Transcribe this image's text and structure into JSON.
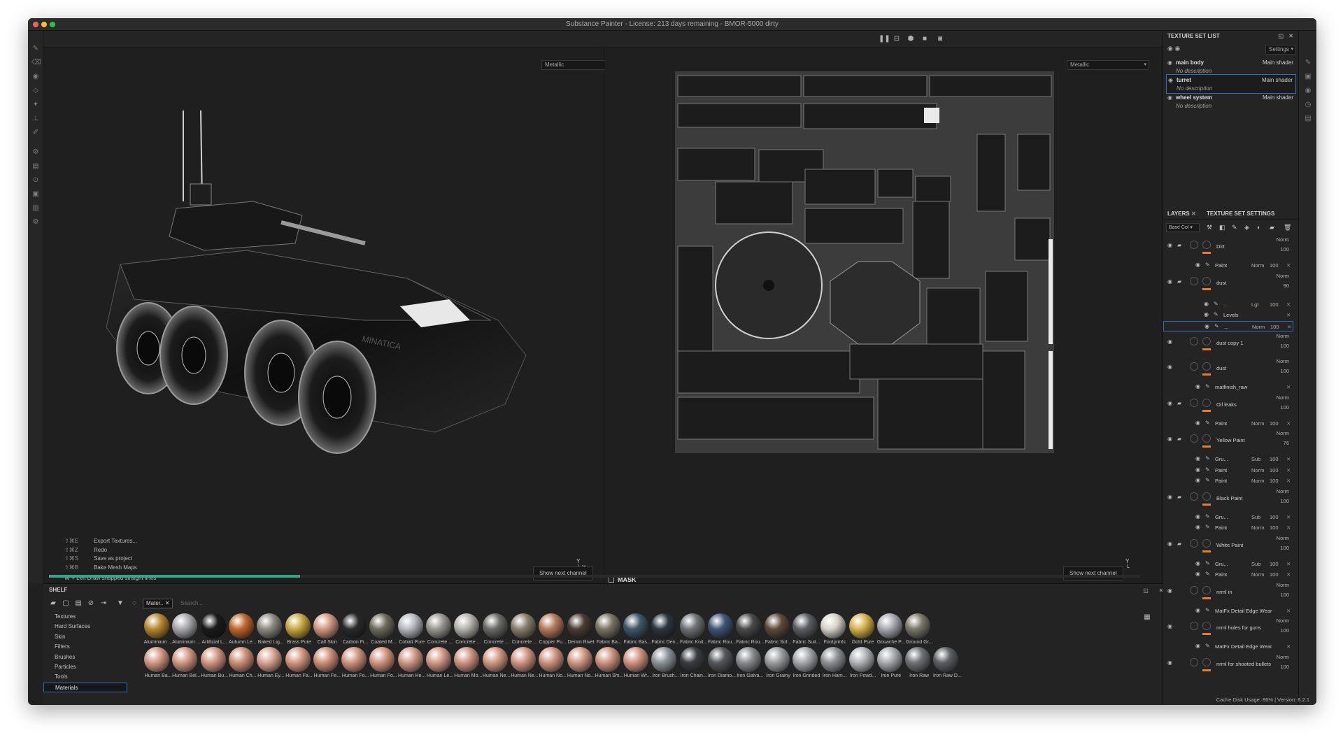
{
  "window": {
    "title": "Substance Painter - License: 213 days remaining - BMOR-5000 dirty"
  },
  "viewport": {
    "left_channel": "Metallic",
    "right_channel": "Metallic",
    "show_next_channel": "Show next channel",
    "mask_label": "MASK",
    "hint": "⌘ + Left  Draw snapped straight lines",
    "shortcuts": [
      {
        "keys": "⇧⌘E",
        "label": "Export Textures..."
      },
      {
        "keys": "⇧⌘Z",
        "label": "Redo"
      },
      {
        "keys": "⇧⌘S",
        "label": "Save as project"
      },
      {
        "keys": "⇧⌘B",
        "label": "Bake Mesh Maps"
      }
    ],
    "decal_text": "MINATICA",
    "progress": 0.23
  },
  "shelf": {
    "title": "SHELF",
    "filter_chip": "Mater..",
    "search_placeholder": "Search...",
    "categories": [
      "Textures",
      "Hard Surfaces",
      "Skin",
      "Filters",
      "Brushes",
      "Particles",
      "Tools",
      "Materials"
    ],
    "active_category": "Materials",
    "materials_row1": [
      "Aluminium ...",
      "Aluminium ...",
      "Artificial L...",
      "Autumn Le...",
      "Baked Lig...",
      "Brass Pure",
      "Calf Skin",
      "Carbon Fi...",
      "Coated M...",
      "Cobalt Pure",
      "Concrete ...",
      "Concrete ...",
      "Concrete ...",
      "Concrete ...",
      "Copper Pu...",
      "Denim Rivet",
      "Fabric Ba...",
      "Fabric Bas...",
      "Fabric Den...",
      "Fabric Knit...",
      "Fabric Rou...",
      "Fabric Rou...",
      "Fabric Sof...",
      "Fabric Suit...",
      "Footprints",
      "Gold Pure",
      "Gouache P...",
      "Ground Gr..."
    ],
    "materials_row2": [
      "Human Ba...",
      "Human Bel...",
      "Human Bu...",
      "Human Ch...",
      "Human Ey...",
      "Human Fa...",
      "Human Fe...",
      "Human Fo...",
      "Human Fo...",
      "Human He...",
      "Human Le...",
      "Human Mo...",
      "Human Ne...",
      "Human Ne...",
      "Human No...",
      "Human No...",
      "Human Shi...",
      "Human Wr...",
      "Iron Brush...",
      "Iron Chain...",
      "Iron Diamo...",
      "Iron Galva...",
      "Iron Grainy",
      "Iron Grinded",
      "Iron Ham...",
      "Iron Powd...",
      "Iron Pure",
      "Iron Raw",
      "Iron Raw D..."
    ],
    "row1_colors": [
      "#b8892e",
      "#a9a9ad",
      "#1a1a1a",
      "#c0672d",
      "#8e8a83",
      "#c9a93f",
      "#d39a82",
      "#2a2a2a",
      "#6f6b5e",
      "#b7b9c0",
      "#9a9892",
      "#b4b3ae",
      "#6a6a69",
      "#8a7f70",
      "#b57a5c",
      "#4b3b34",
      "#7a7464",
      "#3e5868",
      "#2d3540",
      "#6f7276",
      "#3e5674",
      "#4a4a4a",
      "#5e4a3c",
      "#5c5e63",
      "#d8d4cc",
      "#d7b34a",
      "#a9aab2",
      "#7a776a"
    ],
    "row2_colors": [
      "#d59a85",
      "#d49a84",
      "#d49883",
      "#cf9079",
      "#dba690",
      "#d69882",
      "#cf9077",
      "#d09580",
      "#d3977f",
      "#d29a85",
      "#d49b86",
      "#d29682",
      "#d29983",
      "#d19782",
      "#cf9580",
      "#d19984",
      "#d09580",
      "#d09580",
      "#8e9399",
      "#3a3c40",
      "#55585c",
      "#8a8c8f",
      "#9c9ea0",
      "#a7a9ac",
      "#8f9194",
      "#b2b4b7",
      "#a9abae",
      "#6f7175",
      "#5d5f62"
    ]
  },
  "texture_sets": {
    "title": "TEXTURE SET LIST",
    "settings_label": "Settings",
    "items": [
      {
        "name": "main body",
        "shader": "Main shader",
        "description": "No description"
      },
      {
        "name": "turret",
        "shader": "Main shader",
        "description": "No description"
      },
      {
        "name": "wheel system",
        "shader": "Main shader",
        "description": "No description"
      }
    ],
    "selected": "turret"
  },
  "layers_panel": {
    "tab_layers": "LAYERS",
    "tab_settings": "TEXTURE SET SETTINGS",
    "channel_dropdown": "Base Col",
    "layers": [
      {
        "name": "Dirt",
        "blend": "Norm",
        "opacity": "100",
        "level": 0,
        "type": "folder"
      },
      {
        "name": "Paint",
        "blend": "Norm",
        "opacity": "100",
        "level": 1,
        "type": "effect"
      },
      {
        "name": "dust",
        "blend": "Norm",
        "opacity": "90",
        "level": 0,
        "type": "folder"
      },
      {
        "name": "...",
        "blend": "Lgt",
        "opacity": "100",
        "level": 2,
        "type": "effect"
      },
      {
        "name": "Levels",
        "blend": "",
        "opacity": "",
        "level": 2,
        "type": "effect"
      },
      {
        "name": "...",
        "blend": "Norm",
        "opacity": "100",
        "level": 2,
        "type": "effect",
        "selected": true
      },
      {
        "name": "dust copy 1",
        "blend": "Norm",
        "opacity": "100",
        "level": 0,
        "type": "fill"
      },
      {
        "name": "dust",
        "blend": "Norm",
        "opacity": "100",
        "level": 0,
        "type": "fill"
      },
      {
        "name": "matfinish_raw",
        "blend": "",
        "opacity": "",
        "level": 1,
        "type": "effect"
      },
      {
        "name": "Oil leaks",
        "blend": "Norm",
        "opacity": "100",
        "level": 0,
        "type": "folder"
      },
      {
        "name": "Paint",
        "blend": "Norm",
        "opacity": "100",
        "level": 1,
        "type": "effect"
      },
      {
        "name": "Yellow Paint",
        "blend": "Norm",
        "opacity": "76",
        "level": 0,
        "type": "folder"
      },
      {
        "name": "Gru...",
        "blend": "Sub",
        "opacity": "100",
        "level": 1,
        "type": "effect"
      },
      {
        "name": "Paint",
        "blend": "Norm",
        "opacity": "100",
        "level": 1,
        "type": "effect"
      },
      {
        "name": "Paint",
        "blend": "Norm",
        "opacity": "100",
        "level": 1,
        "type": "effect"
      },
      {
        "name": "Black Paint",
        "blend": "Norm",
        "opacity": "100",
        "level": 0,
        "type": "folder"
      },
      {
        "name": "Gru...",
        "blend": "Sub",
        "opacity": "100",
        "level": 1,
        "type": "effect"
      },
      {
        "name": "Paint",
        "blend": "Norm",
        "opacity": "100",
        "level": 1,
        "type": "effect"
      },
      {
        "name": "White Paint",
        "blend": "Norm",
        "opacity": "100",
        "level": 0,
        "type": "folder"
      },
      {
        "name": "Gru...",
        "blend": "Sub",
        "opacity": "100",
        "level": 1,
        "type": "effect"
      },
      {
        "name": "Paint",
        "blend": "Norm",
        "opacity": "100",
        "level": 1,
        "type": "effect"
      },
      {
        "name": "nrml in",
        "blend": "Norm",
        "opacity": "100",
        "level": 0,
        "type": "fill"
      },
      {
        "name": "MatFx Detail Edge Wear",
        "blend": "",
        "opacity": "",
        "level": 1,
        "type": "effect"
      },
      {
        "name": "nrml holes for guns",
        "blend": "Norm",
        "opacity": "100",
        "level": 0,
        "type": "fill"
      },
      {
        "name": "MatFx Detail Edge Wear",
        "blend": "",
        "opacity": "",
        "level": 1,
        "type": "effect"
      },
      {
        "name": "nrml for shooted bullets",
        "blend": "Norm",
        "opacity": "100",
        "level": 0,
        "type": "fill"
      }
    ]
  },
  "status": {
    "cache": "Cache Disk Usage:",
    "cache_value": "86%",
    "version": "Version: 6.2.1"
  },
  "colors": {
    "accent_blue": "#2c6fb7",
    "progress_green": "#2ea88a",
    "orange": "#e57f22"
  }
}
